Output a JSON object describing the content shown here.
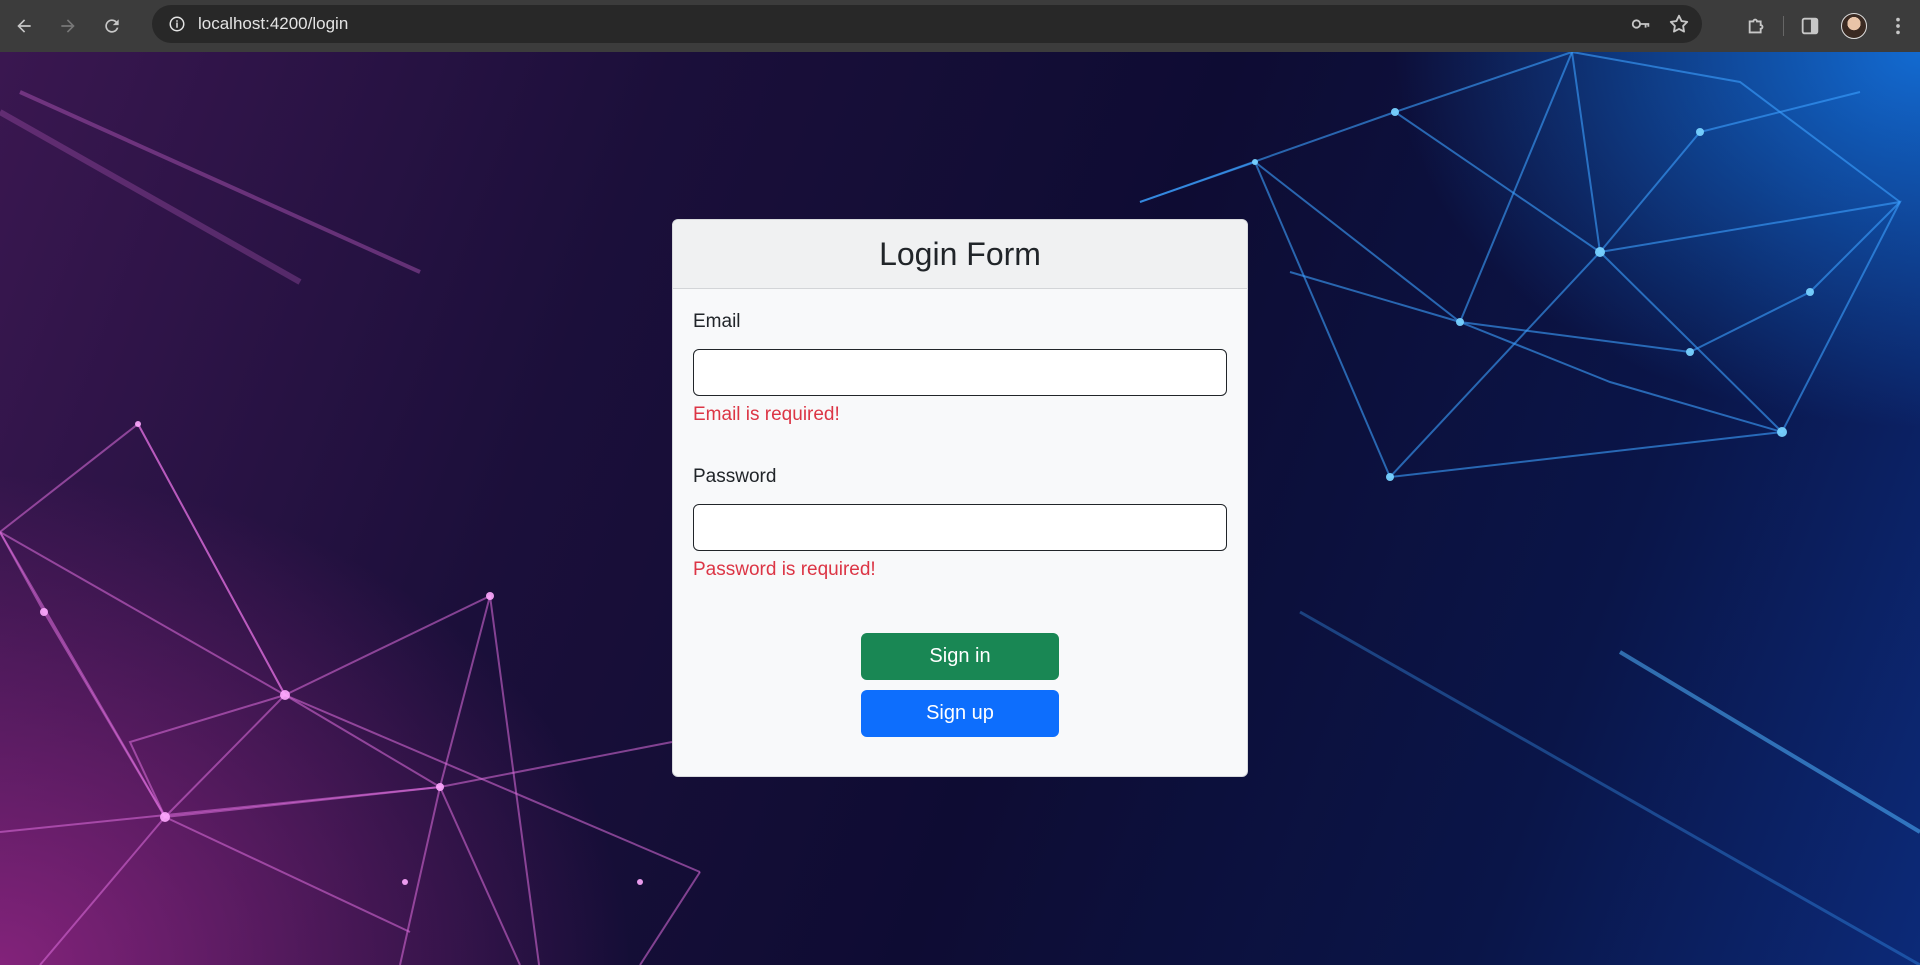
{
  "browser": {
    "url": "localhost:4200/login",
    "icons": [
      "back-icon",
      "forward-icon",
      "reload-icon",
      "site-info-icon",
      "password-key-icon",
      "bookmark-star-icon",
      "extensions-icon",
      "side-panel-icon",
      "profile-avatar",
      "menu-dots-icon"
    ]
  },
  "login": {
    "title": "Login Form",
    "email": {
      "label": "Email",
      "value": "",
      "error": "Email is required!"
    },
    "password": {
      "label": "Password",
      "value": "",
      "error": "Password is required!"
    },
    "sign_in_label": "Sign in",
    "sign_up_label": "Sign up"
  },
  "colors": {
    "sign_in": "#198754",
    "sign_up": "#0d6efd",
    "error": "#dc3545"
  }
}
